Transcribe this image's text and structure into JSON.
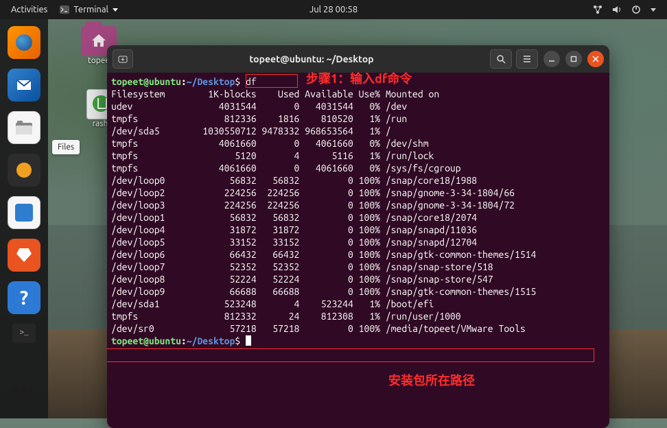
{
  "topbar": {
    "activities": "Activities",
    "app_label": "Terminal",
    "clock": "Jul 28  00:58"
  },
  "dock": {
    "tooltip_files": "Files"
  },
  "desktop": {
    "home_folder_label": "topee",
    "trash_label": "rash"
  },
  "terminal": {
    "title": "topeet@ubuntu: ~/Desktop",
    "prompt_user": "topeet@ubuntu",
    "prompt_path": "~/Desktop",
    "prompt_symbol": "$",
    "command": "df",
    "header_row": "Filesystem        1K-blocks    Used Available Use% Mounted on",
    "rows": [
      {
        "fs": "udev",
        "blocks": "4031544",
        "used": "0",
        "avail": "4031544",
        "usep": "0%",
        "mount": "/dev"
      },
      {
        "fs": "tmpfs",
        "blocks": "812336",
        "used": "1816",
        "avail": "810520",
        "usep": "1%",
        "mount": "/run"
      },
      {
        "fs": "/dev/sda5",
        "blocks": "1030550712",
        "used": "9478332",
        "avail": "968653564",
        "usep": "1%",
        "mount": "/"
      },
      {
        "fs": "tmpfs",
        "blocks": "4061660",
        "used": "0",
        "avail": "4061660",
        "usep": "0%",
        "mount": "/dev/shm"
      },
      {
        "fs": "tmpfs",
        "blocks": "5120",
        "used": "4",
        "avail": "5116",
        "usep": "1%",
        "mount": "/run/lock"
      },
      {
        "fs": "tmpfs",
        "blocks": "4061660",
        "used": "0",
        "avail": "4061660",
        "usep": "0%",
        "mount": "/sys/fs/cgroup"
      },
      {
        "fs": "/dev/loop0",
        "blocks": "56832",
        "used": "56832",
        "avail": "0",
        "usep": "100%",
        "mount": "/snap/core18/1988"
      },
      {
        "fs": "/dev/loop2",
        "blocks": "224256",
        "used": "224256",
        "avail": "0",
        "usep": "100%",
        "mount": "/snap/gnome-3-34-1804/66"
      },
      {
        "fs": "/dev/loop3",
        "blocks": "224256",
        "used": "224256",
        "avail": "0",
        "usep": "100%",
        "mount": "/snap/gnome-3-34-1804/72"
      },
      {
        "fs": "/dev/loop1",
        "blocks": "56832",
        "used": "56832",
        "avail": "0",
        "usep": "100%",
        "mount": "/snap/core18/2074"
      },
      {
        "fs": "/dev/loop4",
        "blocks": "31872",
        "used": "31872",
        "avail": "0",
        "usep": "100%",
        "mount": "/snap/snapd/11036"
      },
      {
        "fs": "/dev/loop5",
        "blocks": "33152",
        "used": "33152",
        "avail": "0",
        "usep": "100%",
        "mount": "/snap/snapd/12704"
      },
      {
        "fs": "/dev/loop6",
        "blocks": "66432",
        "used": "66432",
        "avail": "0",
        "usep": "100%",
        "mount": "/snap/gtk-common-themes/1514"
      },
      {
        "fs": "/dev/loop7",
        "blocks": "52352",
        "used": "52352",
        "avail": "0",
        "usep": "100%",
        "mount": "/snap/snap-store/518"
      },
      {
        "fs": "/dev/loop8",
        "blocks": "52224",
        "used": "52224",
        "avail": "0",
        "usep": "100%",
        "mount": "/snap/snap-store/547"
      },
      {
        "fs": "/dev/loop9",
        "blocks": "66688",
        "used": "66688",
        "avail": "0",
        "usep": "100%",
        "mount": "/snap/gtk-common-themes/1515"
      },
      {
        "fs": "/dev/sda1",
        "blocks": "523248",
        "used": "4",
        "avail": "523244",
        "usep": "1%",
        "mount": "/boot/efi"
      },
      {
        "fs": "tmpfs",
        "blocks": "812332",
        "used": "24",
        "avail": "812308",
        "usep": "1%",
        "mount": "/run/user/1000"
      },
      {
        "fs": "/dev/sr0",
        "blocks": "57218",
        "used": "57218",
        "avail": "0",
        "usep": "100%",
        "mount": "/media/topeet/VMware Tools"
      }
    ]
  },
  "annotations": {
    "step1": "步骤1：输入df命令",
    "path_note": "安装包所在路径"
  }
}
